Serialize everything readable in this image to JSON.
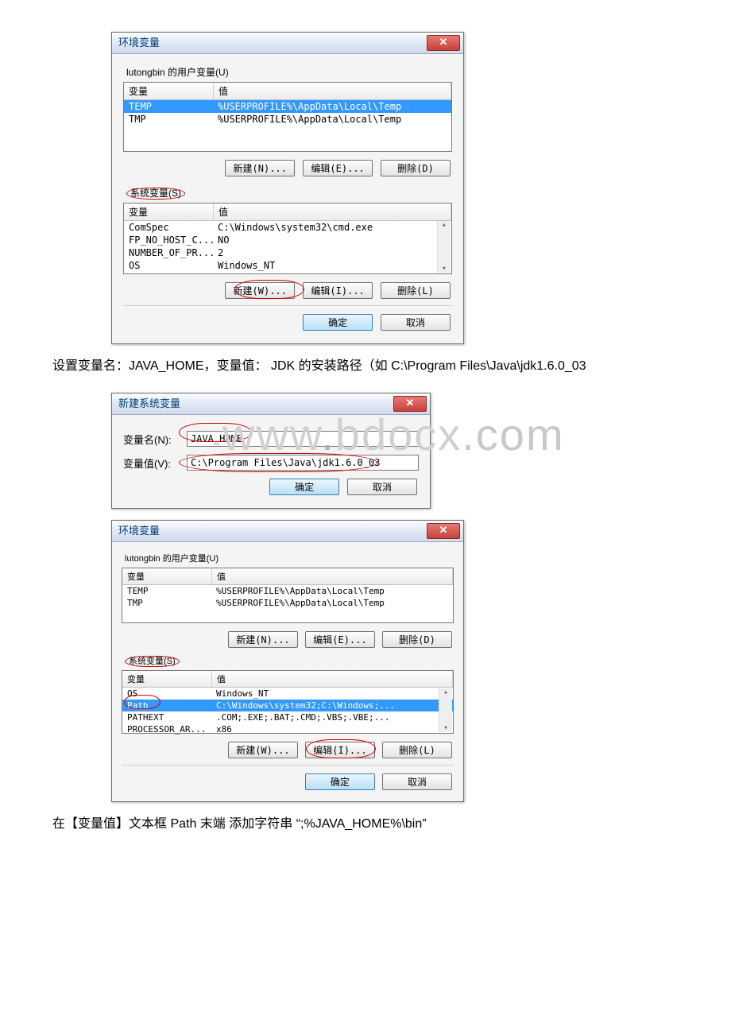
{
  "dialog1": {
    "title": "环境变量",
    "close": "✕",
    "userSection": "lutongbin 的用户变量(U)",
    "headers": {
      "var": "变量",
      "val": "值"
    },
    "userRows": [
      {
        "var": "TEMP",
        "val": "%USERPROFILE%\\AppData\\Local\\Temp",
        "selected": true
      },
      {
        "var": "TMP",
        "val": "%USERPROFILE%\\AppData\\Local\\Temp"
      }
    ],
    "btnNewUser": "新建(N)...",
    "btnEditUser": "编辑(E)...",
    "btnDelUser": "删除(D)",
    "sysSection": "系统变量(S)",
    "sysRows": [
      {
        "var": "ComSpec",
        "val": "C:\\Windows\\system32\\cmd.exe"
      },
      {
        "var": "FP_NO_HOST_C...",
        "val": "NO"
      },
      {
        "var": "NUMBER_OF_PR...",
        "val": "2"
      },
      {
        "var": "OS",
        "val": "Windows_NT"
      }
    ],
    "btnNewSys": "新建(W)...",
    "btnEditSys": "编辑(I)...",
    "btnDelSys": "删除(L)",
    "ok": "确定",
    "cancel": "取消"
  },
  "para1": "设置变量名：JAVA_HOME，变量值： JDK 的安装路径（如 C:\\Program Files\\Java\\jdk1.6.0_03",
  "dialogNew": {
    "title": "新建系统变量",
    "close": "✕",
    "nameLabel": "变量名(N):",
    "nameValue": "JAVA_HOME",
    "valLabel": "变量值(V):",
    "valValue": "C:\\Program Files\\Java\\jdk1.6.0_03",
    "ok": "确定",
    "cancel": "取消"
  },
  "watermark": {
    "w1": "www",
    "dot": ".",
    "w2": "bdocx",
    "com": ".com"
  },
  "dialog2": {
    "title": "环境变量",
    "close": "✕",
    "userSection": "lutongbin 的用户变量(U)",
    "headers": {
      "var": "变量",
      "val": "值"
    },
    "userRows": [
      {
        "var": "TEMP",
        "val": "%USERPROFILE%\\AppData\\Local\\Temp"
      },
      {
        "var": "TMP",
        "val": "%USERPROFILE%\\AppData\\Local\\Temp"
      }
    ],
    "btnNewUser": "新建(N)...",
    "btnEditUser": "编辑(E)...",
    "btnDelUser": "删除(D)",
    "sysSection": "系统变量(S)",
    "sysRows": [
      {
        "var": "OS",
        "val": "Windows_NT"
      },
      {
        "var": "Path",
        "val": "C:\\Windows\\system32;C:\\Windows;...",
        "selected": true
      },
      {
        "var": "PATHEXT",
        "val": ".COM;.EXE;.BAT;.CMD;.VBS;.VBE;..."
      },
      {
        "var": "PROCESSOR_AR...",
        "val": "x86"
      }
    ],
    "btnNewSys": "新建(W)...",
    "btnEditSys": "编辑(I)...",
    "btnDelSys": "删除(L)",
    "ok": "确定",
    "cancel": "取消"
  },
  "para2": "在【变量值】文本框 Path 末端 添加字符串 “;%JAVA_HOME%\\bin”"
}
